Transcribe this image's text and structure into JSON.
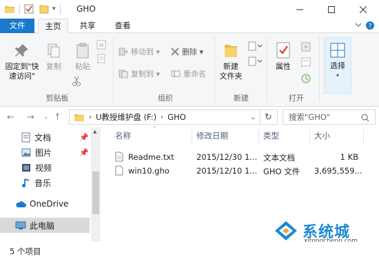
{
  "window": {
    "title": "GHO"
  },
  "tabs": [
    {
      "label": "文件"
    },
    {
      "label": "主页"
    },
    {
      "label": "共享"
    },
    {
      "label": "查看"
    }
  ],
  "ribbon": {
    "clipboard": {
      "pin_label_line1": "固定到\"快",
      "pin_label_line2": "速访问\"",
      "copy_label": "复制",
      "paste_label": "粘贴",
      "group_label": "剪贴板"
    },
    "organize": {
      "move_to": "移动到 ▾",
      "copy_to": "复制到 ▾",
      "delete": "删除 ▾",
      "rename": "重命名",
      "group_label": "组织"
    },
    "new": {
      "new_folder_line1": "新建",
      "new_folder_line2": "文件夹",
      "group_label": "新建"
    },
    "open": {
      "properties": "属性",
      "group_label": "打开"
    },
    "select": {
      "select": "选择"
    }
  },
  "address": {
    "breadcrumb": [
      "U教授维护盘 (F:)",
      "GHO"
    ],
    "search_placeholder": "搜索\"GHO\""
  },
  "navigation": {
    "items": [
      {
        "label": "文档",
        "icon": "document-icon",
        "pinned": true
      },
      {
        "label": "图片",
        "icon": "picture-icon",
        "pinned": true
      },
      {
        "label": "视频",
        "icon": "video-icon",
        "pinned": false
      },
      {
        "label": "音乐",
        "icon": "music-icon",
        "pinned": false
      },
      {
        "label": "OneDrive",
        "icon": "cloud-icon",
        "pinned": false
      },
      {
        "label": "此电脑",
        "icon": "computer-icon",
        "pinned": false
      }
    ]
  },
  "columns": {
    "name": "名称",
    "date": "修改日期",
    "type": "类型",
    "size": "大小"
  },
  "files": [
    {
      "name": "Readme.txt",
      "date": "2015/12/30 1...",
      "type": "文本文档",
      "size": "1 KB"
    },
    {
      "name": "win10.gho",
      "date": "2015/12/10 1...",
      "type": "GHO 文件",
      "size": "3,695,559..."
    }
  ],
  "status": {
    "item_count": "5 个项目"
  },
  "watermark": {
    "brand": "系统城",
    "url": "xitongcheng.com"
  },
  "colors": {
    "accent": "#1979ca",
    "ribbon_bg": "#f5f6f7",
    "selected_nav": "#d9d9d9"
  }
}
